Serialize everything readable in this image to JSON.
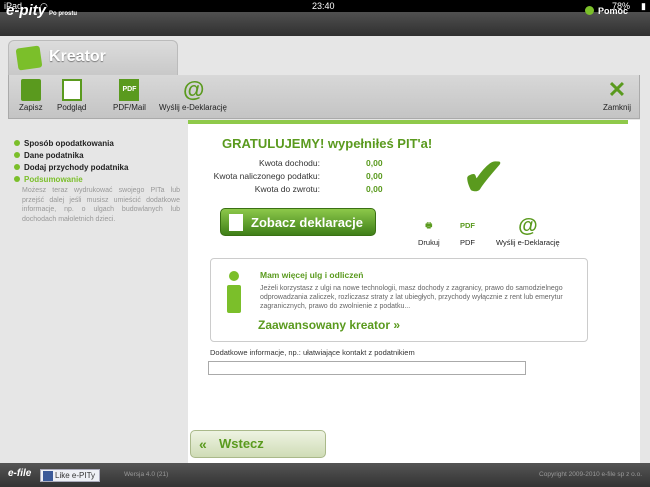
{
  "status": {
    "device": "iPad",
    "time": "23:40",
    "battery": "78%"
  },
  "header": {
    "logo": "e-pity",
    "logo_tag": "Po prostu",
    "help": "Pomoc"
  },
  "tab": {
    "title": "Kreator"
  },
  "toolbar": {
    "save": "Zapisz",
    "preview": "Podgląd",
    "pdf": "PDF/Mail",
    "send": "Wyślij e-Deklarację",
    "close": "Zamknij"
  },
  "sidebar": {
    "items": [
      {
        "label": "Sposób opodatkowania"
      },
      {
        "label": "Dane podatnika"
      },
      {
        "label": "Dodaj przychody podatnika"
      },
      {
        "label": "Podsumowanie"
      }
    ],
    "description": "Możesz teraz wydrukować swojego PITa lub przejść dalej jeśli musisz umieścić dodatkowe informacje, np. o ulgach budowlanych lub dochodach małoletnich dzieci."
  },
  "summary": {
    "title": "GRATULUJEMY! wypełniłeś PIT'a!",
    "rows": [
      {
        "label": "Kwota dochodu:",
        "value": "0,00"
      },
      {
        "label": "Kwota naliczonego podatku:",
        "value": "0,00"
      },
      {
        "label": "Kwota do zwrotu:",
        "value": "0,00"
      }
    ]
  },
  "actions": {
    "show": "Zobacz deklaracje",
    "print": "Drukuj",
    "pdf": "PDF",
    "pdf_icon": "PDF",
    "send": "Wyślij e-Deklarację"
  },
  "ulgi": {
    "title": "Mam więcej ulg i odliczeń",
    "text": "Jeżeli korzystasz z ulgi na nowe technologii, masz dochody z zagranicy, prawo do samodzielnego odprowadzania zaliczek, rozliczasz straty z lat ubiegłych, przychody wyłącznie z rent lub emerytur zagranicznych, prawo do zwolnienie z podatku...",
    "link": "Zaawansowany kreator"
  },
  "additional": {
    "label": "Dodatkowe informacje, np.: ułatwiające kontakt z podatnikiem",
    "value": ""
  },
  "nav": {
    "back": "Wstecz"
  },
  "footer": {
    "brand": "e-file",
    "like": "Like e-PITy",
    "version": "Wersja 4.0 (21)",
    "copyright": "Copyright 2009-2010 e-file sp z o.o."
  },
  "colors": {
    "accent": "#5a9a1e",
    "accent_light": "#7bbf2a"
  }
}
